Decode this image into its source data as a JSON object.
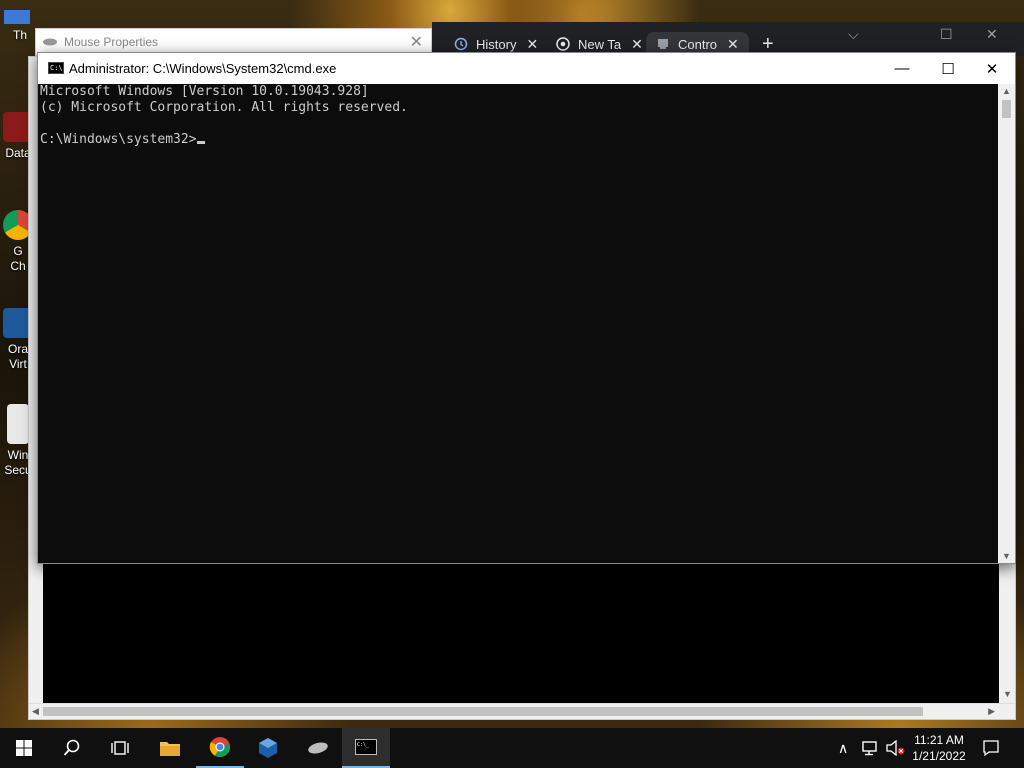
{
  "desktop": {
    "icons": [
      {
        "label": "Th",
        "icon": "partial-icon"
      },
      {
        "label": "Data",
        "icon": "database-shortcut-icon"
      },
      {
        "label": "G",
        "icon": "chrome-shortcut-icon"
      },
      {
        "label": "Ch",
        "icon": ""
      },
      {
        "label": "Ora",
        "icon": "virtualbox-shortcut-icon"
      },
      {
        "label": "Virt",
        "icon": ""
      },
      {
        "label": "Win",
        "icon": "windows-security-icon"
      },
      {
        "label": "Secu",
        "icon": ""
      }
    ]
  },
  "mouse_window": {
    "title": "Mouse Properties",
    "close": "✕"
  },
  "chrome": {
    "tabs": [
      {
        "label": "History",
        "icon": "history-icon"
      },
      {
        "label": "New Ta",
        "icon": "chrome-icon"
      },
      {
        "label": "Contro",
        "icon": "control-panel-icon"
      }
    ],
    "new_tab": "+",
    "controls": {
      "dropdown": "⌵",
      "maximize": "☐",
      "close": "✕"
    }
  },
  "cmd": {
    "title": "Administrator: C:\\Windows\\System32\\cmd.exe",
    "app_icon_text": "C:\\",
    "controls": {
      "minimize": "—",
      "maximize": "☐",
      "close": "✕"
    },
    "lines": [
      "Microsoft Windows [Version 10.0.19043.928]",
      "(c) Microsoft Corporation. All rights reserved.",
      "",
      "C:\\Windows\\system32>"
    ]
  },
  "taskbar": {
    "items": [
      "start-icon",
      "search-icon",
      "task-view-icon",
      "file-explorer-icon",
      "chrome-icon",
      "virtualbox-icon",
      "mouse-icon",
      "cmd-icon"
    ],
    "tray": {
      "chevron": "∧",
      "network": "network-icon",
      "volume": "volume-muted-icon"
    },
    "time": "11:21 AM",
    "date": "1/21/2022",
    "notifications": "notification-icon"
  }
}
